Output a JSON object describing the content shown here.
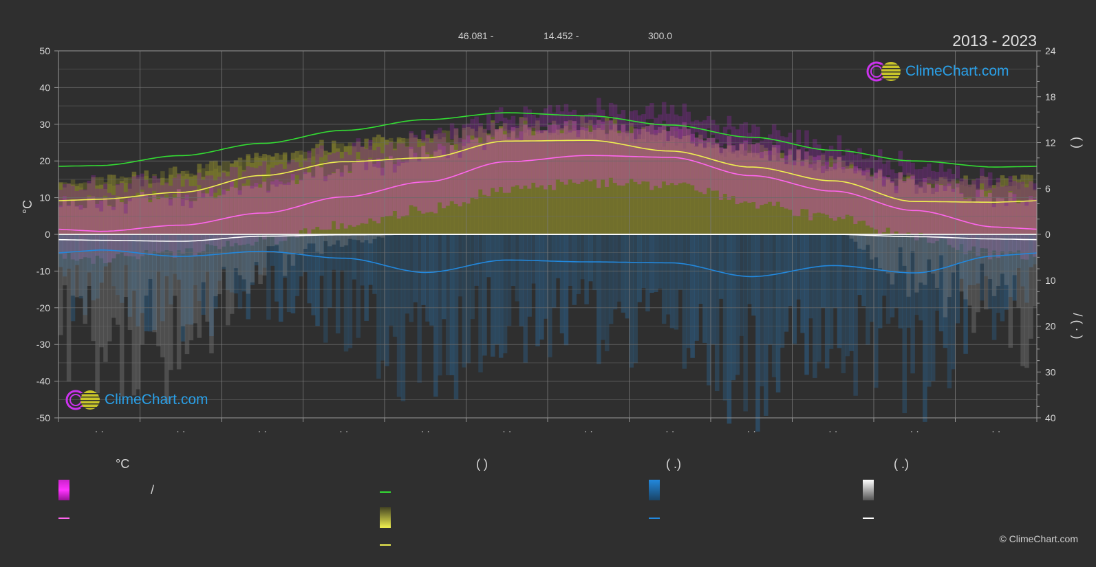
{
  "header": {
    "coord1": "46.081 -",
    "coord2": "14.452 -",
    "elevation": "300.0",
    "years": "2013 - 2023"
  },
  "logo": {
    "text": "ClimeChart.com"
  },
  "copyright": "© ClimeChart.com",
  "colors": {
    "background": "#2f2f2f",
    "daylight": "#33dd33",
    "sunshine": "#f0f050",
    "temp_mean": "#ff66ee",
    "precip": "#2288dd",
    "snow": "#ffffff",
    "logo": "#2aa0e8"
  },
  "legend": {
    "col1_header": "°C",
    "col1_slash": "/",
    "col2_header": "(          )",
    "col3_header": "(   .)",
    "col4_header": "(   .)"
  },
  "chart_data": {
    "type": "line",
    "x_tick_labels": [
      "· ·",
      "· ·",
      "· ·",
      "· ·",
      "· ·",
      "· ·",
      "· ·",
      "· ·",
      "· ·",
      "· ·",
      "· ·",
      "· ·"
    ],
    "ylabel_left": "°C",
    "ylabel_right_upper": "(     )",
    "ylabel_right_lower": "/     (   ·   )",
    "y_left_ticks": [
      "50",
      "40",
      "30",
      "20",
      "10",
      "0",
      "-10",
      "-20",
      "-30",
      "-40",
      "-50"
    ],
    "y_left_range": [
      -50,
      50
    ],
    "y_right_upper_ticks": [
      "24",
      "18",
      "12",
      "6",
      "0"
    ],
    "y_right_lower_ticks": [
      "10",
      "20",
      "30",
      "40"
    ],
    "y_right_upper_range_hours": [
      0,
      24
    ],
    "y_right_lower_range_mm": [
      0,
      40
    ],
    "grid": true,
    "x": [
      0.5,
      1.5,
      2.5,
      3.5,
      4.5,
      5.5,
      6.5,
      7.5,
      8.5,
      9.5,
      10.5,
      11.5
    ],
    "series": [
      {
        "key": "daylight_hours",
        "values": [
          9.0,
          10.3,
          11.9,
          13.6,
          15.0,
          15.9,
          15.5,
          14.3,
          12.7,
          11.0,
          9.6,
          8.8
        ]
      },
      {
        "key": "sunshine_hours",
        "values": [
          4.6,
          5.5,
          7.7,
          9.5,
          10.0,
          12.2,
          12.3,
          10.9,
          8.8,
          7.0,
          4.3,
          4.2
        ]
      },
      {
        "key": "temp_mean_c",
        "values": [
          0.8,
          2.5,
          5.8,
          10.2,
          14.3,
          19.8,
          21.5,
          21.0,
          16.0,
          11.8,
          6.5,
          2.0
        ]
      },
      {
        "key": "snow_mm",
        "values": [
          1.3,
          1.5,
          0.4,
          0.1,
          0.0,
          0.0,
          0.0,
          0.0,
          0.0,
          0.0,
          0.5,
          1.0
        ]
      },
      {
        "key": "precip_mm",
        "values": [
          3.4,
          4.8,
          3.7,
          5.2,
          8.3,
          5.6,
          6.0,
          6.2,
          9.2,
          6.8,
          8.4,
          4.7
        ]
      }
    ]
  }
}
